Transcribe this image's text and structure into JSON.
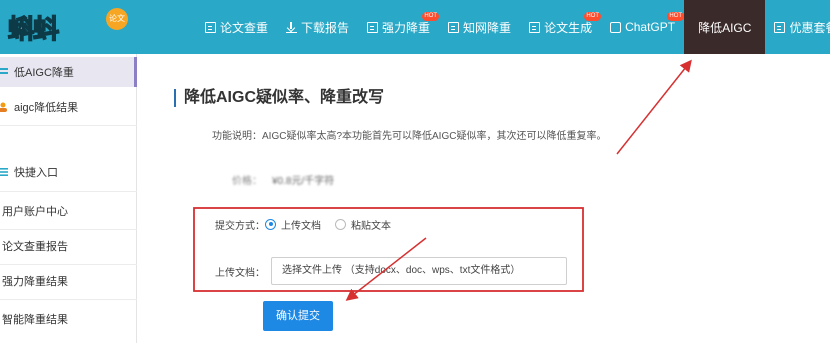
{
  "logo": {
    "text": "蝌蚪",
    "badge": "论文"
  },
  "nav": {
    "items": [
      {
        "label": "论文查重",
        "icon": "document-icon"
      },
      {
        "label": "下载报告",
        "icon": "download-icon"
      },
      {
        "label": "强力降重",
        "icon": "document-icon",
        "hot": "HOT"
      },
      {
        "label": "知网降重",
        "icon": "document-icon"
      },
      {
        "label": "论文生成",
        "icon": "document-icon",
        "hot": "HOT"
      },
      {
        "label": "ChatGPT",
        "icon": "chat-icon",
        "hot": "HOT"
      },
      {
        "label": "降低AIGC",
        "active": true
      },
      {
        "label": "优惠套餐",
        "icon": "document-icon"
      }
    ]
  },
  "sidebar": {
    "items": [
      {
        "label": "低AIGC降重",
        "active": true
      },
      {
        "label": "aigc降低结果"
      },
      {
        "label": "快捷入口"
      },
      {
        "label": "用户账户中心"
      },
      {
        "label": "论文查重报告"
      },
      {
        "label": "强力降重结果"
      },
      {
        "label": "智能降重结果"
      }
    ]
  },
  "main": {
    "title": "降低AIGC疑似率、降重改写",
    "desc_label": "功能说明：",
    "desc_text": "AIGC疑似率太高?本功能首先可以降低AIGC疑似率，其次还可以降低重复率。",
    "price_label": "价格：",
    "price_value": "¥0.8元/千字符",
    "submit_method_label": "提交方式：",
    "option_upload": "上传文档",
    "option_paste": "粘贴文本",
    "upload_label": "上传文档：",
    "upload_hint": "选择文件上传 （支持docx、doc、wps、txt文件格式）",
    "submit_button": "确认提交"
  },
  "colors": {
    "topbar": "#2aa8c7",
    "active_nav": "#3b2a2a",
    "primary": "#1e88e5",
    "annotation": "#d63031"
  }
}
